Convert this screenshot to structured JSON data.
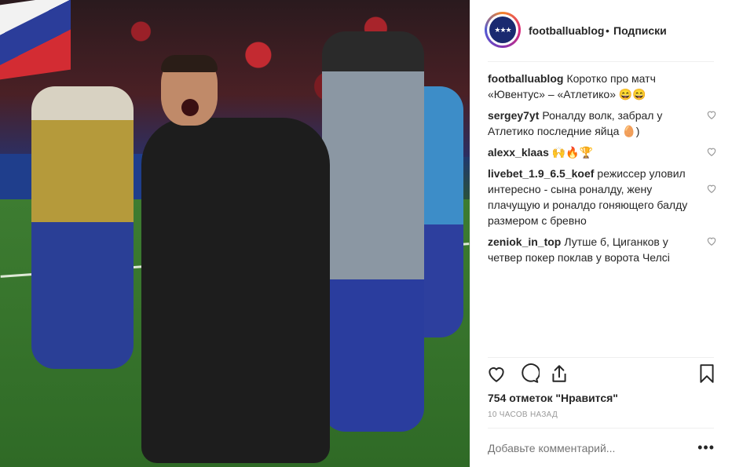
{
  "post": {
    "username": "footballuablog",
    "separator": "•",
    "follow_label": "Подписки",
    "caption": {
      "user": "footballuablog",
      "text": "Коротко про матч «Ювентус» – «Атлетико» 😄😄"
    }
  },
  "comments": [
    {
      "user": "sergey7yt",
      "text": "Роналду волк, забрал у Атлетико последние яйца 🥚)"
    },
    {
      "user": "alexx_klaas",
      "text": "🙌🔥🏆"
    },
    {
      "user": "livebet_1.9_6.5_koef",
      "text": "режиссер уловил интересно - сына роналду, жену плачущую и роналдо гоняющего балду размером с бревно"
    },
    {
      "user": "zeniok_in_top",
      "text": "Лутше б, Циганков у четвер покер поклав у ворота Челсі"
    }
  ],
  "stats": {
    "likes": "754 отметок \"Нравится\"",
    "time": "10 часов назад"
  },
  "add_comment": {
    "placeholder": "Добавьте комментарий..."
  },
  "more_label": "•••",
  "icons": [
    "heart-icon",
    "comment-icon",
    "share-icon",
    "bookmark-icon",
    "comment-like-icon"
  ]
}
